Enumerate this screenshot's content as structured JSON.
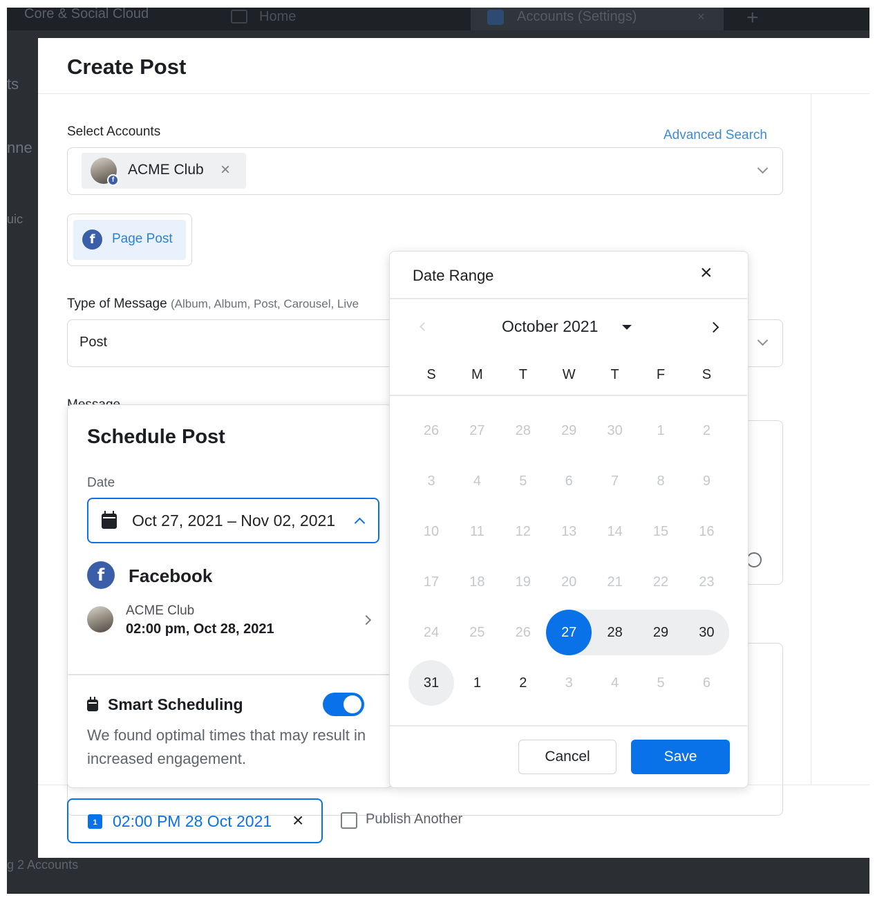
{
  "background": {
    "workspace": "Core & Social Cloud",
    "home_tab": "Home",
    "active_tab": "Accounts (Settings)",
    "tab_close": "×",
    "new_tab": "+",
    "side_fragments": [
      "ts",
      "nne",
      "uic"
    ],
    "bottom_text": "g 2 Accounts"
  },
  "modal": {
    "title": "Create Post",
    "select_accounts_label": "Select Accounts",
    "advanced_search": "Advanced Search",
    "account_chip": "ACME Club",
    "chip_remove": "×",
    "page_post": "Page Post",
    "type_label": "Type of Message",
    "type_sub": "(Album, Album, Post, Carousel, Live",
    "type_value": "Post",
    "message_label": "Message"
  },
  "schedule": {
    "title": "Schedule Post",
    "date_label": "Date",
    "date_value": "Oct 27, 2021 – Nov 02, 2021",
    "network": "Facebook",
    "account_name": "ACME Club",
    "account_time": "02:00 pm, Oct 28, 2021",
    "smart_title": "Smart Scheduling",
    "smart_enabled": true,
    "smart_desc": "We found optimal times that may result in increased engagement."
  },
  "footer": {
    "time_chip": "02:00 PM 28 Oct 2021",
    "time_chip_remove": "×",
    "publish_another": "Publish Another",
    "publish_another_checked": false
  },
  "date_range": {
    "title": "Date Range",
    "close": "×",
    "month": "October 2021",
    "weekdays": [
      "S",
      "M",
      "T",
      "W",
      "T",
      "F",
      "S"
    ],
    "weeks": [
      [
        "26",
        "27",
        "28",
        "29",
        "30",
        "1",
        "2"
      ],
      [
        "3",
        "4",
        "5",
        "6",
        "7",
        "8",
        "9"
      ],
      [
        "10",
        "11",
        "12",
        "13",
        "14",
        "15",
        "16"
      ],
      [
        "17",
        "18",
        "19",
        "20",
        "21",
        "22",
        "23"
      ],
      [
        "24",
        "25",
        "26",
        "27",
        "28",
        "29",
        "30"
      ],
      [
        "31",
        "1",
        "2",
        "3",
        "4",
        "5",
        "6"
      ]
    ],
    "range_start": "27",
    "range_end": "31",
    "cancel": "Cancel",
    "save": "Save"
  },
  "colors": {
    "accent": "#0a72e8",
    "link": "#3a8bdb",
    "facebook": "#3b5ea8",
    "range_band": "#eceef0"
  },
  "icons": [
    "calendar-icon",
    "facebook-icon",
    "close-icon",
    "chevron-down-icon",
    "chevron-right-icon",
    "emoji-icon"
  ]
}
